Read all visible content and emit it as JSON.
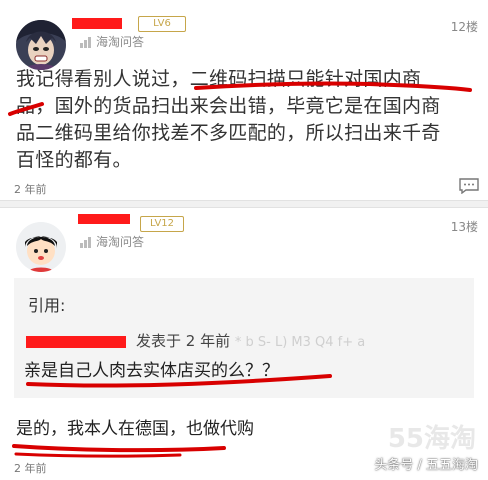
{
  "post1": {
    "level": "LV6",
    "source": "海淘问答",
    "floor": "12楼",
    "lines": [
      "我记得看别人说过，二维码扫描只能针对国内商",
      "品，国外的货品扫出来会出错，毕竟它是在国内商",
      "品二维码里给你找差不多匹配的，所以扫出来千奇",
      "百怪的都有。"
    ],
    "time": "2 年前"
  },
  "post2": {
    "level": "LV12",
    "source": "海淘问答",
    "floor": "13楼",
    "quote_label": "引用:",
    "quote_meta": "发表于 2 年前",
    "quote_ghost": "* b  S- L) M3 Q4 f+ a",
    "quote_text": "亲是自己人肉去实体店买的么？？",
    "reply": "是的，我本人在德国，也做代购",
    "time": "2 年前"
  },
  "watermark": "55海淘",
  "watermark_author": "头条号 / 五五海淘",
  "colors": {
    "redaction": "#ff1a1a",
    "level_gold": "#c6a64a",
    "underline": "#d80000"
  },
  "icons": [
    "user-avatar-icon",
    "signal-bars-icon",
    "comment-icon"
  ]
}
